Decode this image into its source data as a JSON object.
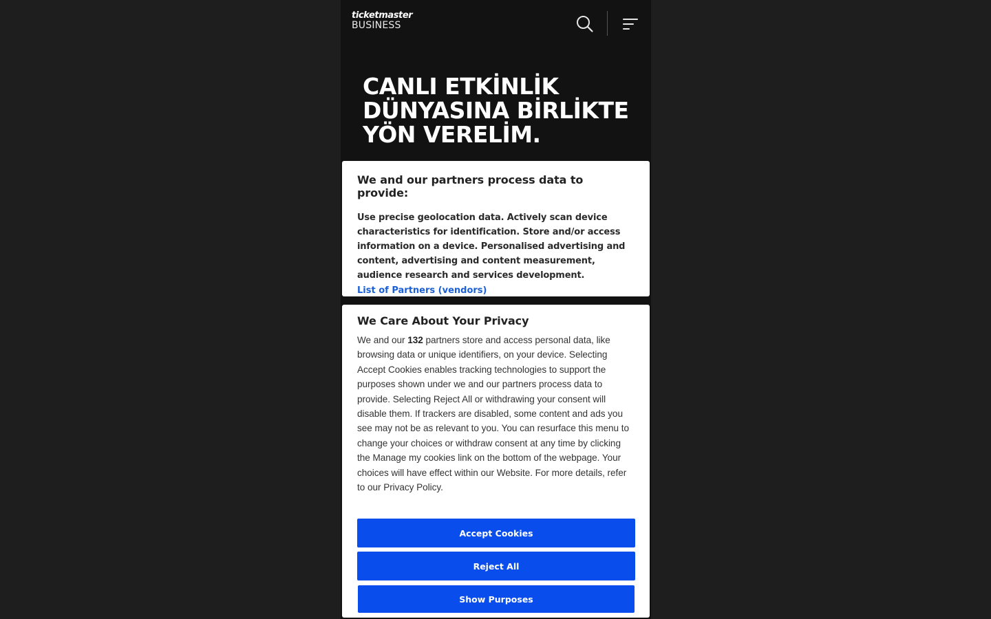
{
  "header": {
    "logo_top": "ticketmaster",
    "logo_bottom": "BUSINESS",
    "search_icon": "search-icon",
    "menu_icon": "menu-icon"
  },
  "hero": {
    "title_line1": "CANLI ETKİNLİK",
    "title_line2": "DÜNYASINA BİRLİKTE",
    "title_line3": "YÖN VERELİM."
  },
  "partners_card": {
    "title": "We and our partners process data to provide:",
    "text": "Use precise geolocation data. Actively scan device characteristics for identification. Store and/or access information on a device. Personalised advertising and content, advertising and content measurement, audience research and services development.",
    "link": "List of Partners (vendors)"
  },
  "privacy_card": {
    "title": "We Care About Your Privacy",
    "text_before_count": "We and our ",
    "partner_count": "132",
    "text_after_count": " partners store and access personal data, like browsing data or unique identifiers, on your device. Selecting Accept Cookies enables tracking technologies to support the purposes shown under we and our partners process data to provide. Selecting Reject All or withdrawing your consent will disable them. If trackers are disabled, some content and ads you see may not be as relevant to you. You can resurface this menu to change your choices or withdraw consent at any time by clicking the Manage my cookies link on the bottom of the webpage. Your choices will have effect within our Website. For more details, refer to our Privacy Policy.",
    "accept_label": "Accept Cookies",
    "reject_label": "Reject All",
    "purposes_label": "Show Purposes"
  },
  "colors": {
    "page_bg": "#1e1e1e",
    "phone_bg": "#121212",
    "button_blue": "#0a4ded",
    "link_blue": "#1a5fd6"
  }
}
